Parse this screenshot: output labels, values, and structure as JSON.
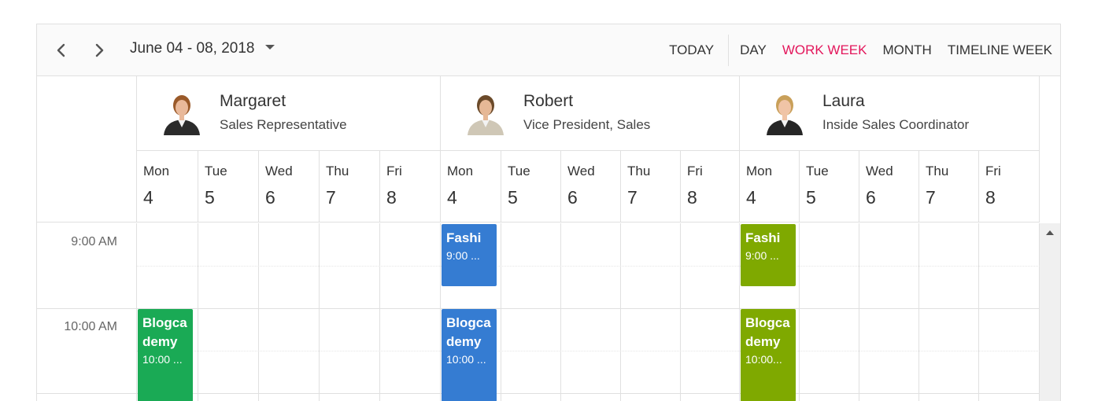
{
  "toolbar": {
    "date_range": "June 04 - 08, 2018",
    "views": [
      {
        "label": "TODAY",
        "active": false
      },
      {
        "label": "DAY",
        "active": false
      },
      {
        "label": "WORK WEEK",
        "active": true
      },
      {
        "label": "MONTH",
        "active": false
      },
      {
        "label": "TIMELINE WEEK",
        "active": false
      }
    ],
    "icons": {
      "prev": "chevron-left-icon",
      "next": "chevron-right-icon",
      "dropdown": "caret-down-icon"
    }
  },
  "resources": [
    {
      "name": "Margaret",
      "title": "Sales Representative",
      "avatar_color": "#2b2b2b",
      "avatar_hair": "#9a5a2a",
      "avatar_skin": "#e9b99a"
    },
    {
      "name": "Robert",
      "title": "Vice President, Sales",
      "avatar_color": "#cfc7b6",
      "avatar_hair": "#6b4a2a",
      "avatar_skin": "#e6b896"
    },
    {
      "name": "Laura",
      "title": "Inside Sales Coordinator",
      "avatar_color": "#262626",
      "avatar_hair": "#c9a05a",
      "avatar_skin": "#f0c4a6"
    }
  ],
  "days": [
    {
      "name": "Mon",
      "num": "4"
    },
    {
      "name": "Tue",
      "num": "5"
    },
    {
      "name": "Wed",
      "num": "6"
    },
    {
      "name": "Thu",
      "num": "7"
    },
    {
      "name": "Fri",
      "num": "8"
    }
  ],
  "times": [
    "9:00 AM",
    "10:00 AM"
  ],
  "appointments": [
    {
      "resource": 0,
      "day": 0,
      "slot": 1,
      "subject": "Blogcademy",
      "time": "10:00 ...",
      "color": "#1aaa55"
    },
    {
      "resource": 1,
      "day": 0,
      "slot": 0,
      "subject": "Fashi",
      "time": "9:00 ...",
      "color": "#357cd2"
    },
    {
      "resource": 1,
      "day": 0,
      "slot": 1,
      "subject": "Blogcademy",
      "time": "10:00 ...",
      "color": "#357cd2"
    },
    {
      "resource": 2,
      "day": 0,
      "slot": 0,
      "subject": "Fashi",
      "time": "9:00 ...",
      "color": "#7fa900"
    },
    {
      "resource": 2,
      "day": 0,
      "slot": 1,
      "subject": "Blogcademy",
      "time": "10:00...",
      "color": "#7fa900"
    }
  ],
  "colors": {
    "accent": "#e3165b",
    "border": "#e0e0e0"
  }
}
